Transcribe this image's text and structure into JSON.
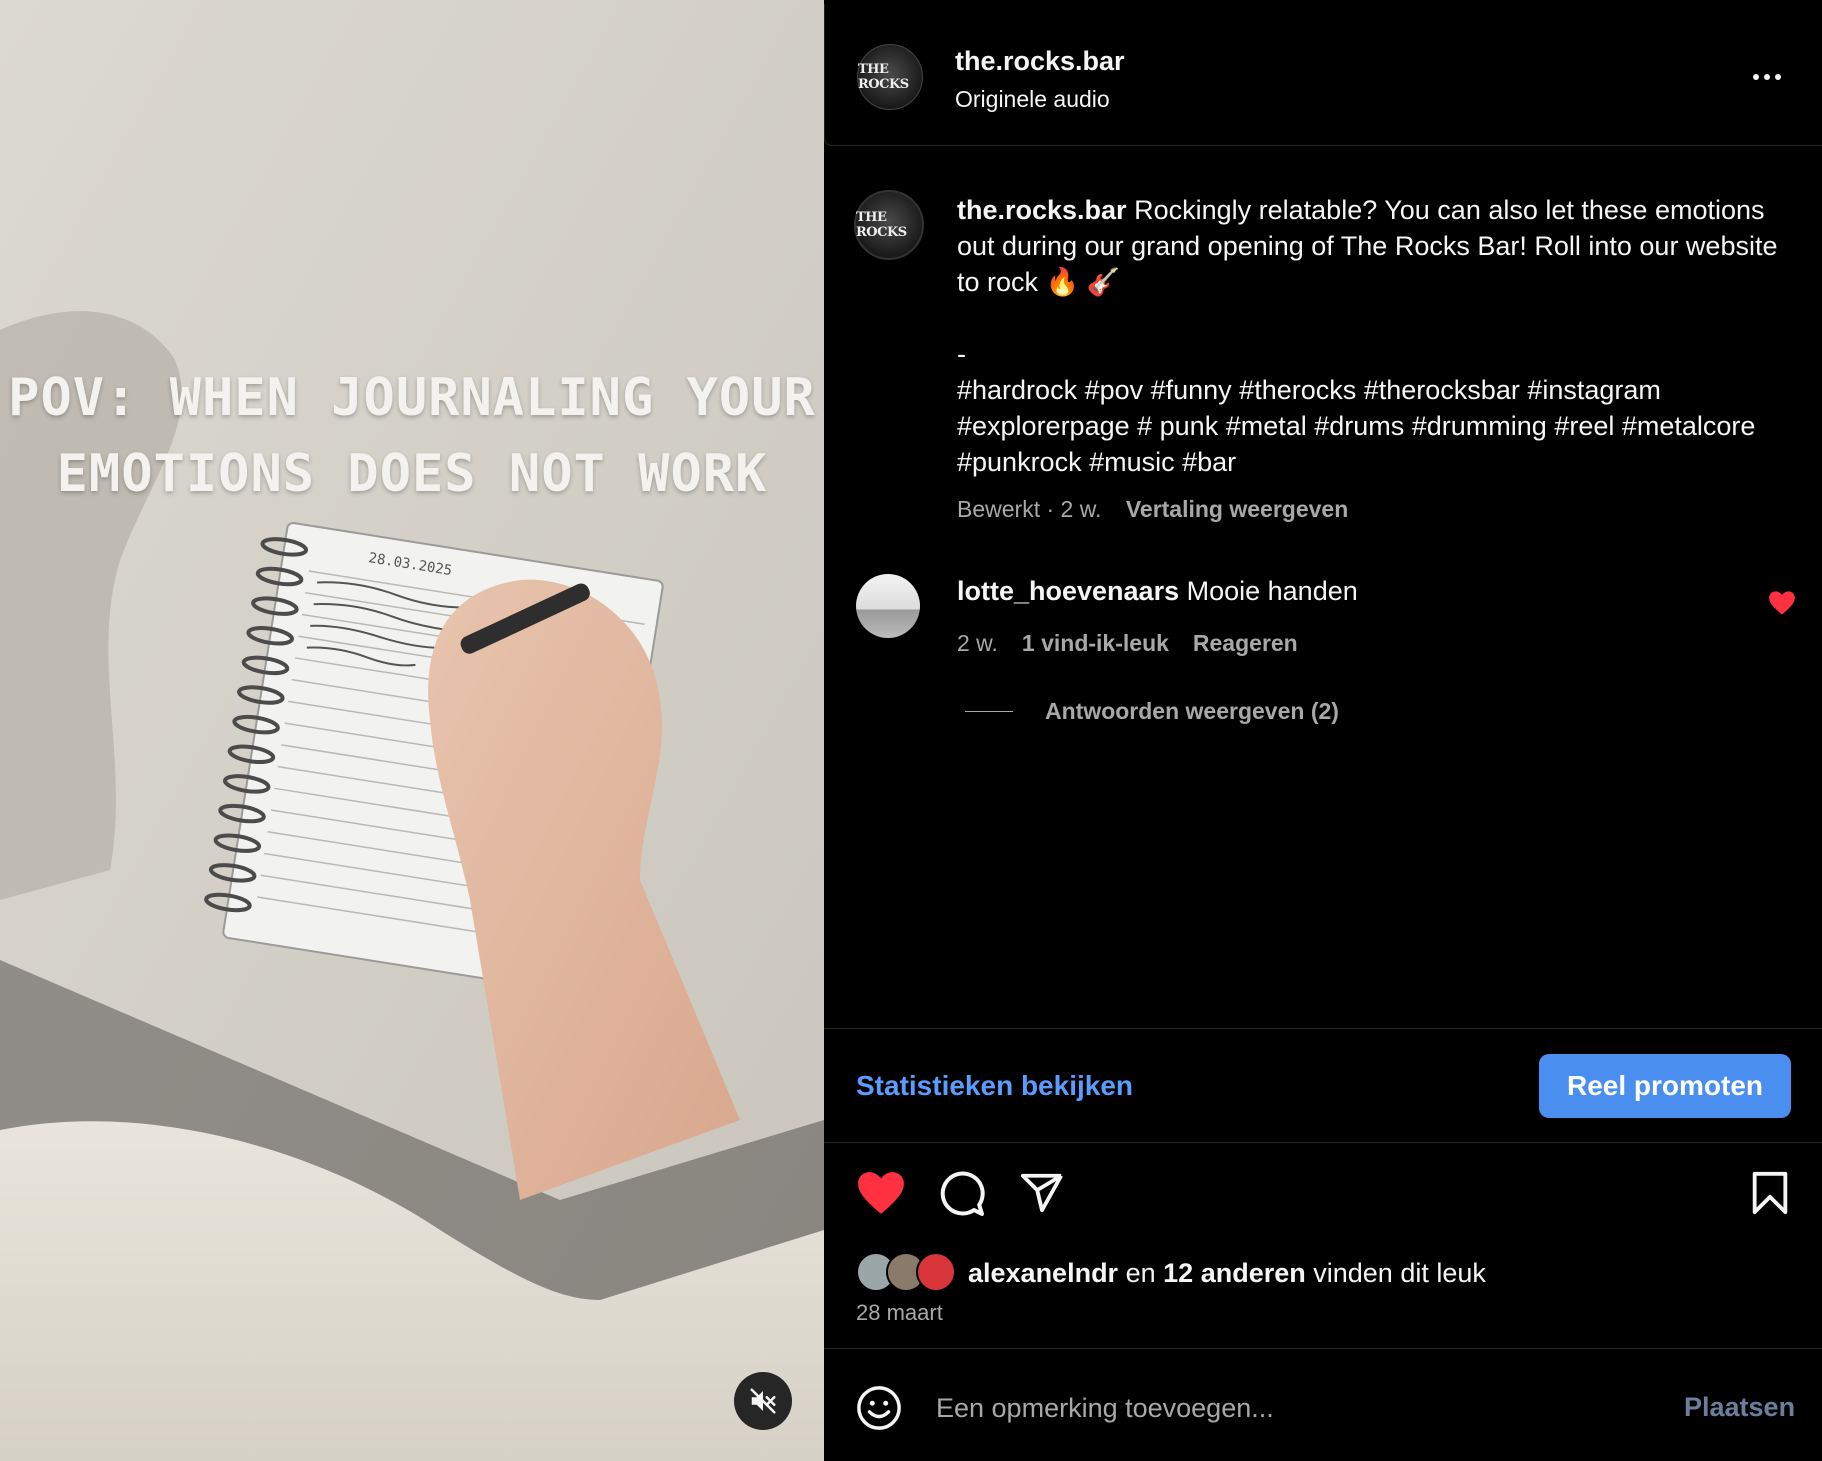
{
  "video": {
    "caption_line1": "POV: WHEN JOURNALING YOUR",
    "caption_line2": "EMOTIONS DOES NOT WORK",
    "notebook_date": "28.03.2025",
    "mute_icon": "speaker-muted-icon"
  },
  "header": {
    "avatar_text": "THE ROCKS",
    "username": "the.rocks.bar",
    "audio": "Originele audio",
    "more_icon": "more-options-icon"
  },
  "caption": {
    "avatar_text": "THE ROCKS",
    "username": "the.rocks.bar",
    "text": "Rockingly relatable? You can also let these emotions out during our grand opening of The Rocks Bar! Roll into our website to rock 🔥 🎸",
    "dash": "-",
    "hashtags": "#hardrock #pov #funny #therocks #therocksbar #instagram #explorerpage # punk #metal #drums #drumming #reel #metalcore #punkrock #music #bar",
    "meta": "Bewerkt · 2 w.",
    "translate": "Vertaling weergeven"
  },
  "comment": {
    "username": "lotte_hoevenaars",
    "text": "Mooie handen",
    "age": "2 w.",
    "likes": "1 vind-ik-leuk",
    "reply": "Reageren",
    "view_replies": "Antwoorden weergeven (2)",
    "liked": true
  },
  "promo": {
    "stats_link": "Statistieken bekijken",
    "promote_button": "Reel promoten"
  },
  "actions": {
    "like_icon": "heart-filled-icon",
    "comment_icon": "comment-bubble-icon",
    "share_icon": "paper-plane-icon",
    "save_icon": "bookmark-icon",
    "liked": true
  },
  "likes": {
    "first_liker": "alexanelndr",
    "joiner": "en",
    "others": "12 anderen",
    "suffix": "vinden dit leuk",
    "date": "28 maart"
  },
  "composer": {
    "placeholder": "Een opmerking toevoegen...",
    "post_label": "Plaatsen",
    "emoji_icon": "emoji-smile-icon"
  },
  "colors": {
    "background": "#000000",
    "link_blue": "#5b9cff",
    "button_blue": "#4a8ff0",
    "like_red": "#ff3040",
    "muted_text": "#a8a8a8"
  }
}
